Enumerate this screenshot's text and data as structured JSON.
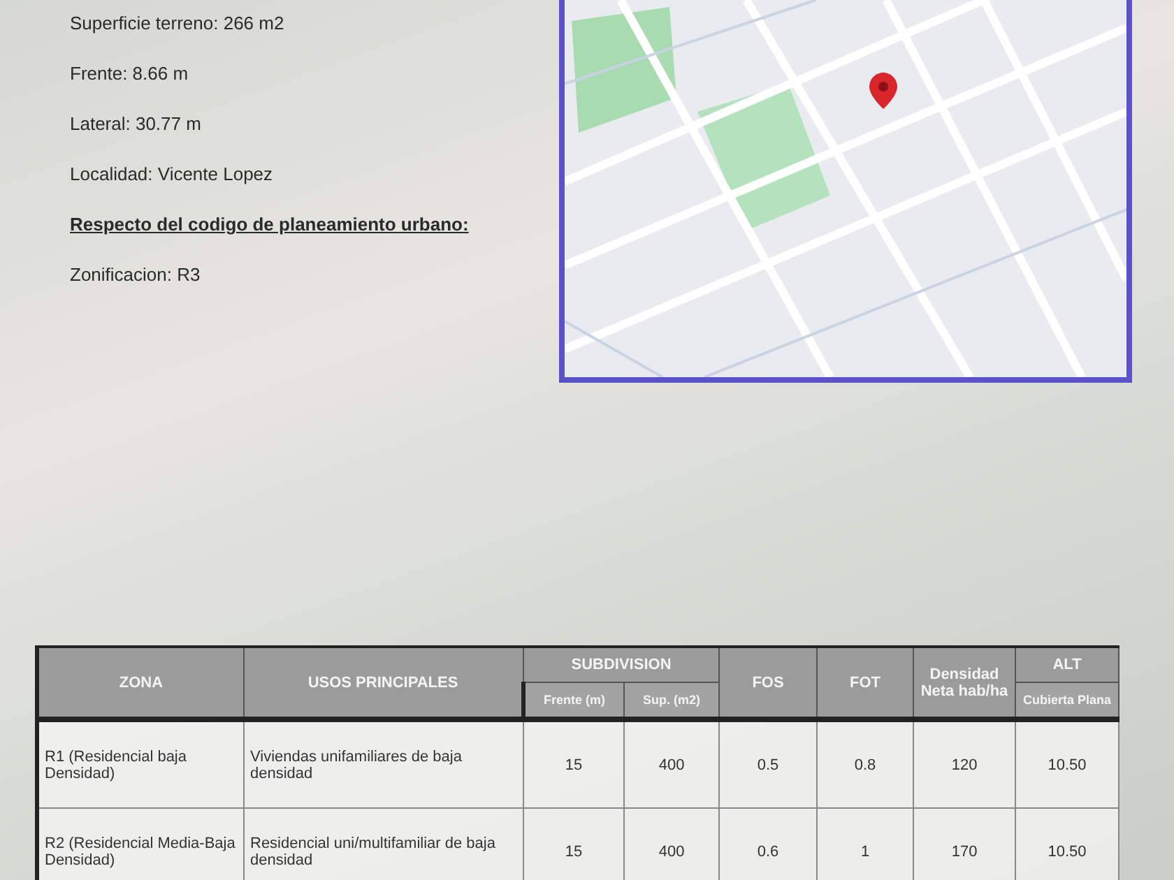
{
  "lot_details": [
    {
      "text": "Superficie terreno: 266 m2",
      "kind": "plain"
    },
    {
      "text": "Frente: 8.66 m",
      "kind": "plain"
    },
    {
      "text": "Lateral: 30.77 m",
      "kind": "plain"
    },
    {
      "text": "Localidad: Vicente Lopez",
      "kind": "plain"
    },
    {
      "text": "Respecto del codigo de planeamiento urbano:",
      "kind": "heading"
    },
    {
      "text": "Zonificacion: R3",
      "kind": "plain"
    }
  ],
  "zoning_table": {
    "header_rows": [
      [
        {
          "text": "ZONA",
          "rowspan": 2
        },
        {
          "text": "USOS PRINCIPALES",
          "rowspan": 2
        },
        {
          "text": "SUBDIVISION",
          "colspan": 2
        },
        {
          "text": "FOS",
          "rowspan": 2
        },
        {
          "text": "FOT",
          "rowspan": 2
        },
        {
          "text": "Densidad Neta hab/ha",
          "rowspan": 2
        },
        {
          "text": "ALT"
        }
      ],
      [
        {
          "text": "Frente (m)"
        },
        {
          "text": "Sup. (m2)"
        },
        {
          "text": "Cubierta Plana"
        }
      ]
    ],
    "rows": [
      [
        "R1 (Residencial baja Densidad)",
        "Viviendas unifamiliares de baja densidad",
        "15",
        "400",
        "0.5",
        "0.8",
        "120",
        "10.50"
      ],
      [
        "R2 (Residencial Media-Baja Densidad)",
        "Residencial uni/multifamiliar de baja densidad",
        "15",
        "400",
        "0.6",
        "1",
        "170",
        "10.50"
      ]
    ]
  }
}
